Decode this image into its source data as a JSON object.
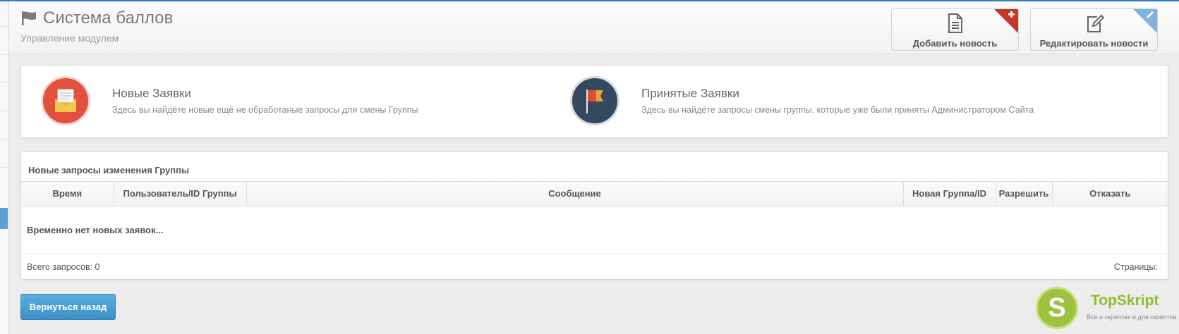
{
  "header": {
    "title": "Система баллов",
    "subtitle": "Управление модулем",
    "title_icon": "flag-icon"
  },
  "toolbar": {
    "add_news": {
      "label": "Добавить новость",
      "icon": "document-icon",
      "badge_icon": "plus-icon",
      "badge_color": "#c0392b"
    },
    "edit_news": {
      "label": "Редактировать новости",
      "icon": "edit-icon",
      "badge_icon": "pencil-icon",
      "badge_color": "#6fa8dc"
    }
  },
  "quick_links": [
    {
      "title": "Новые Заявки",
      "description": "Здесь вы найдёте новые ещё не обработаные запросы для смены Группы",
      "icon": "envelope-icon",
      "color": "#e0513e"
    },
    {
      "title": "Принятые Заявки",
      "description": "Здесь вы найдёте запросы смены группы, которые уже были приняты Администратором Сайта",
      "icon": "flag-icon",
      "color": "#34495e"
    }
  ],
  "requests_table": {
    "title": "Новые запросы изменения Группы",
    "columns": [
      "Время",
      "Пользователь/ID Группы",
      "Сообщение",
      "Новая Группа/ID",
      "Разрешить",
      "Отказать"
    ],
    "empty_message": "Временно нет новых заявок...",
    "total_label": "Всего запросов: 0",
    "pages_label": "Страницы:"
  },
  "back_button": {
    "label": "Вернуться назад"
  },
  "watermark": {
    "brand": "TopSkript",
    "tagline": "Все о скриптах и для скриптов..."
  }
}
